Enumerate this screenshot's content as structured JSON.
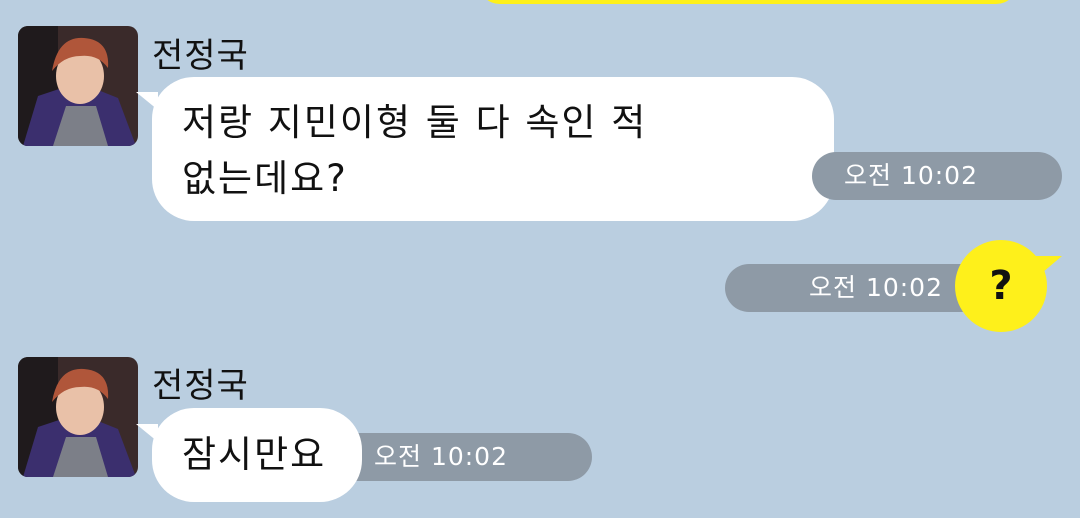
{
  "colors": {
    "background": "#bacee0",
    "their_bubble": "#ffffff",
    "my_bubble": "#fef01b",
    "time_pill": "#8e9aa6"
  },
  "messages": [
    {
      "sender": "전정국",
      "lines": [
        "저랑 지민이형 둘 다 속인 적",
        "없는데요?"
      ],
      "time": "오전 10:02"
    },
    {
      "sender": "me",
      "text": "?",
      "time": "오전 10:02"
    },
    {
      "sender": "전정국",
      "text": "잠시만요",
      "time": "오전 10:02"
    }
  ]
}
